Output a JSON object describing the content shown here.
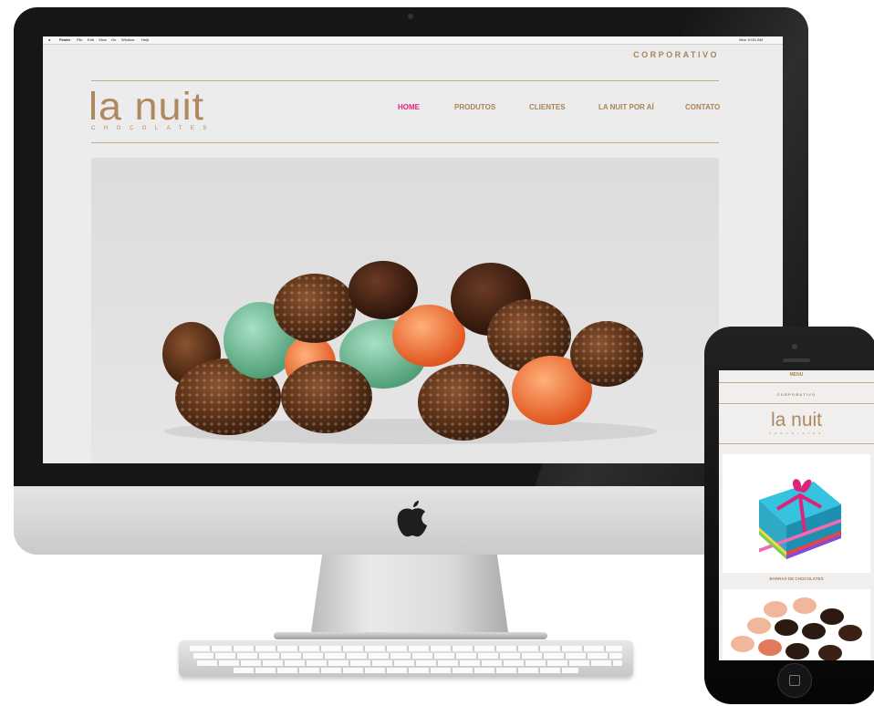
{
  "desktop": {
    "menubar": {
      "apple": "",
      "items": [
        "Finder",
        "File",
        "Edit",
        "View",
        "Go",
        "Window",
        "Help"
      ],
      "clock": "Mon 10:51 AM"
    },
    "site": {
      "corporate_link": "CORPORATIVO",
      "logo": "la nuit",
      "logo_tagline": "CHOCOLATES",
      "nav": [
        "HOME",
        "PRODUTOS",
        "CLIENTES",
        "LA NUIT POR AÍ",
        "CONTATO"
      ],
      "nav_active": "HOME"
    }
  },
  "mobile": {
    "menu_label": "MENU",
    "corporate_link": "CORPORATIVO",
    "logo": "la nuit",
    "logo_tagline": "CHOCOLATES",
    "product_caption": "BARRAS DE CHOCOLATES"
  },
  "colors": {
    "brand": "#b08860",
    "nav_active": "#e0237a",
    "screen_bg": "#ececec"
  },
  "icons": [
    "apple-logo-icon",
    "home-button-icon",
    "camera-icon"
  ]
}
